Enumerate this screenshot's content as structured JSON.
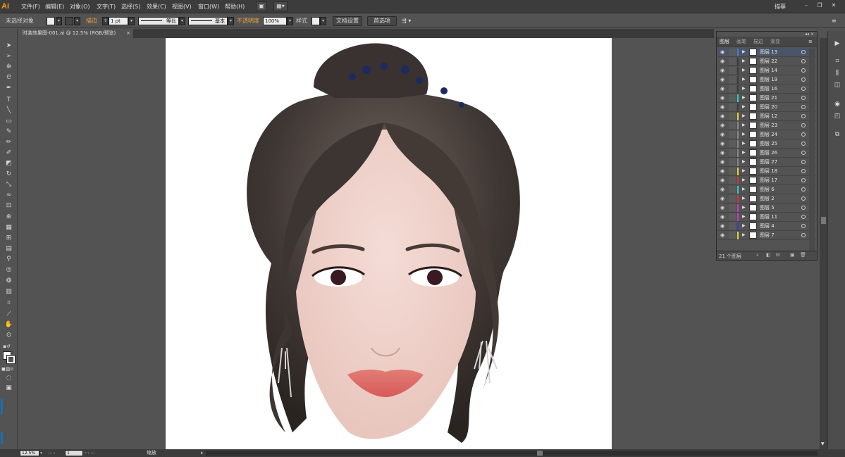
{
  "menu": {
    "items": [
      "文件(F)",
      "编辑(E)",
      "对象(O)",
      "文字(T)",
      "选择(S)",
      "效果(C)",
      "视图(V)",
      "窗口(W)",
      "帮助(H)"
    ],
    "workspace": "描摹",
    "logo": "Ai"
  },
  "control": {
    "selection": "未选择对象",
    "stroke_label": "描边",
    "stroke_weight": "1 pt",
    "profile": "等比",
    "brush": "基本",
    "opacity_label": "不透明度",
    "opacity_value": "100%",
    "style_label": "样式",
    "doc_setup": "文档设置",
    "prefs": "首选项"
  },
  "document": {
    "tab": "时装效果图-001.ai @ 12.5% (RGB/预览)",
    "close": "×"
  },
  "status": {
    "zoom": "12.5%",
    "page": "1",
    "tool": "缩放"
  },
  "panel": {
    "tabs": [
      "图层",
      "画笔",
      "描边",
      "渐变"
    ],
    "count": "21 个图层",
    "layers": [
      {
        "name": "图层 13",
        "color": "#4a7bd6"
      },
      {
        "name": "图层 22",
        "color": "#3c3c3c"
      },
      {
        "name": "图层 14",
        "color": "#3c3c3c"
      },
      {
        "name": "图层 19",
        "color": "#3c3c3c"
      },
      {
        "name": "图层 16",
        "color": "#3c3c3c"
      },
      {
        "name": "图层 21",
        "color": "#36c8c8"
      },
      {
        "name": "图层 20",
        "color": "#3c3c3c"
      },
      {
        "name": "图层 12",
        "color": "#e6d23c"
      },
      {
        "name": "图层 23",
        "color": "#888888"
      },
      {
        "name": "图层 24",
        "color": "#888888"
      },
      {
        "name": "图层 25",
        "color": "#888888"
      },
      {
        "name": "图层 26",
        "color": "#888888"
      },
      {
        "name": "图层 27",
        "color": "#888888"
      },
      {
        "name": "图层 18",
        "color": "#e6d23c"
      },
      {
        "name": "图层 17",
        "color": "#c83c3c"
      },
      {
        "name": "图层 6",
        "color": "#36c8c8"
      },
      {
        "name": "图层 2",
        "color": "#c83c3c"
      },
      {
        "name": "图层 5",
        "color": "#c83cc8"
      },
      {
        "name": "图层 11",
        "color": "#c83cc8"
      },
      {
        "name": "图层 4",
        "color": "#3c3cc8"
      },
      {
        "name": "图层 7",
        "color": "#e6d23c"
      }
    ]
  }
}
